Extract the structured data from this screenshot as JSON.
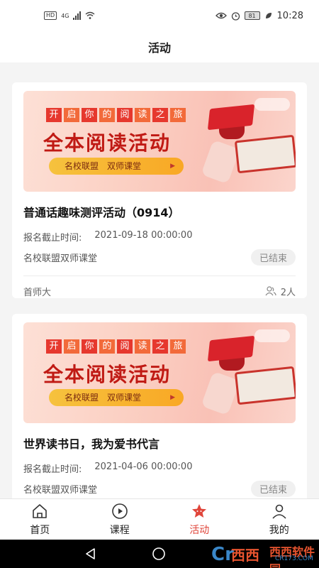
{
  "status_bar": {
    "left_badge": "HD",
    "network": "4G",
    "battery": "81",
    "time": "10:28"
  },
  "header": {
    "title": "活动"
  },
  "banner": {
    "tagline_chars": [
      "开",
      "启",
      "你",
      "的",
      "阅",
      "读",
      "之",
      "旅"
    ],
    "headline": "全本阅读活动",
    "pill": "名校联盟　双师课堂"
  },
  "activities": [
    {
      "title": "普通话趣味测评活动（0914）",
      "deadline_label": "报名截止时间:",
      "deadline_value": "2021-09-18 00:00:00",
      "org": "名校联盟双师课堂",
      "status": "已结束",
      "publisher": "首师大",
      "participants": "2人"
    },
    {
      "title": "世界读书日，我为爱书代言",
      "deadline_label": "报名截止时间:",
      "deadline_value": "2021-04-06 00:00:00",
      "org": "名校联盟双师课堂",
      "status": "已结束"
    }
  ],
  "tabbar": {
    "items": [
      {
        "label": "首页",
        "icon": "home-icon"
      },
      {
        "label": "课程",
        "icon": "play-circle-icon"
      },
      {
        "label": "活动",
        "icon": "star-icon",
        "active": true
      },
      {
        "label": "我的",
        "icon": "user-icon"
      }
    ]
  },
  "watermark": {
    "text": "西西软件园",
    "domain": "CR173.COM"
  },
  "colors": {
    "accent": "#e0453a",
    "background": "#f4f4f4"
  }
}
